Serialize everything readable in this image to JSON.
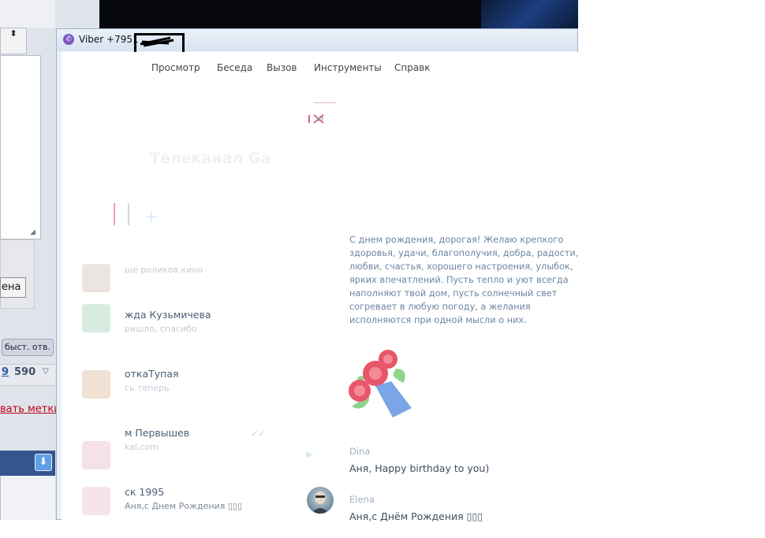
{
  "background_app": {
    "cancel_button_label": "ена",
    "quick_reply_label": "быст. отв.",
    "count_a": "9",
    "count_b": "590",
    "count_arrow": "▽",
    "tags_link": "вать метки",
    "scroll_glyph": "⬍",
    "download_glyph": "⬇"
  },
  "window": {
    "title": "Viber +7951",
    "icon_glyph": "✆"
  },
  "menu": {
    "items": [
      "Просмотр",
      "Беседа",
      "Вызов",
      "Инструменты",
      "Справк"
    ]
  },
  "conversation_header": {
    "title": "Телеканал Gа",
    "subtitle": "vi"
  },
  "contacts": [
    {
      "name": "",
      "message": "ше роликов кино"
    },
    {
      "name": "жда Кузьмичева",
      "message": "ришло, спасибо"
    },
    {
      "name": "откаТупая",
      "message": "сь теперь"
    },
    {
      "name": "м Первышев",
      "message": "kal.com"
    },
    {
      "name": "ск 1995",
      "message": "Аня,с Днем Рождения ▯▯▯"
    }
  ],
  "chat": {
    "birthday_text": "С днем рождения, дорогая! Желаю крепкого здоровья, удачи, благополучия, добра, радости, любви, счастья, хорошего настроения, улыбок, ярких впечатлений. Пусть тепло и уют всегда наполняют твой дом, пусть солнечный свет согревает в любую погоду, а желания исполняются при одной мысли о них.",
    "messages": [
      {
        "sender": "Dina",
        "text": "Аня,  Happy birthday to you)"
      },
      {
        "sender": "Elena",
        "text": "Аня,с Днём Рождения ▯▯▯"
      }
    ]
  },
  "colors": {
    "viber_purple": "#7e56c2",
    "sticker_red": "#e8566a",
    "sticker_blue": "#7aa6e8",
    "sticker_green": "#8fd48b"
  }
}
